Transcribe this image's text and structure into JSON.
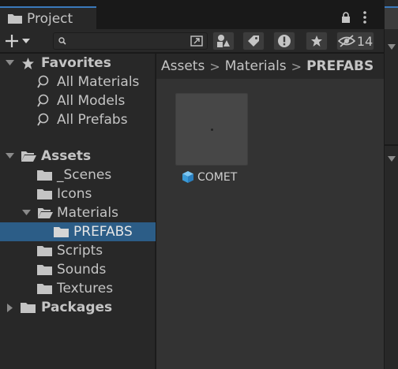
{
  "tab": {
    "title": "Project",
    "icon": "folder-icon"
  },
  "toolbar": {
    "search_placeholder": "",
    "hidden_count": "14",
    "colors": {
      "accent": "#3a79bb",
      "selection": "#2c5d87",
      "panel": "#282828"
    }
  },
  "tree": {
    "favorites": {
      "label": "Favorites",
      "items": [
        "All Materials",
        "All Models",
        "All Prefabs"
      ]
    },
    "assets": {
      "label": "Assets",
      "items": [
        {
          "label": "_Scenes"
        },
        {
          "label": "Icons"
        },
        {
          "label": "Materials"
        },
        {
          "label": "PREFABS"
        },
        {
          "label": "Scripts"
        },
        {
          "label": "Sounds"
        },
        {
          "label": "Textures"
        }
      ]
    },
    "packages": {
      "label": "Packages"
    }
  },
  "breadcrumb": {
    "items": [
      "Assets",
      "Materials",
      "PREFABS"
    ]
  },
  "content": {
    "asset": {
      "name": "COMET",
      "icon": "prefab-cube-icon"
    }
  }
}
